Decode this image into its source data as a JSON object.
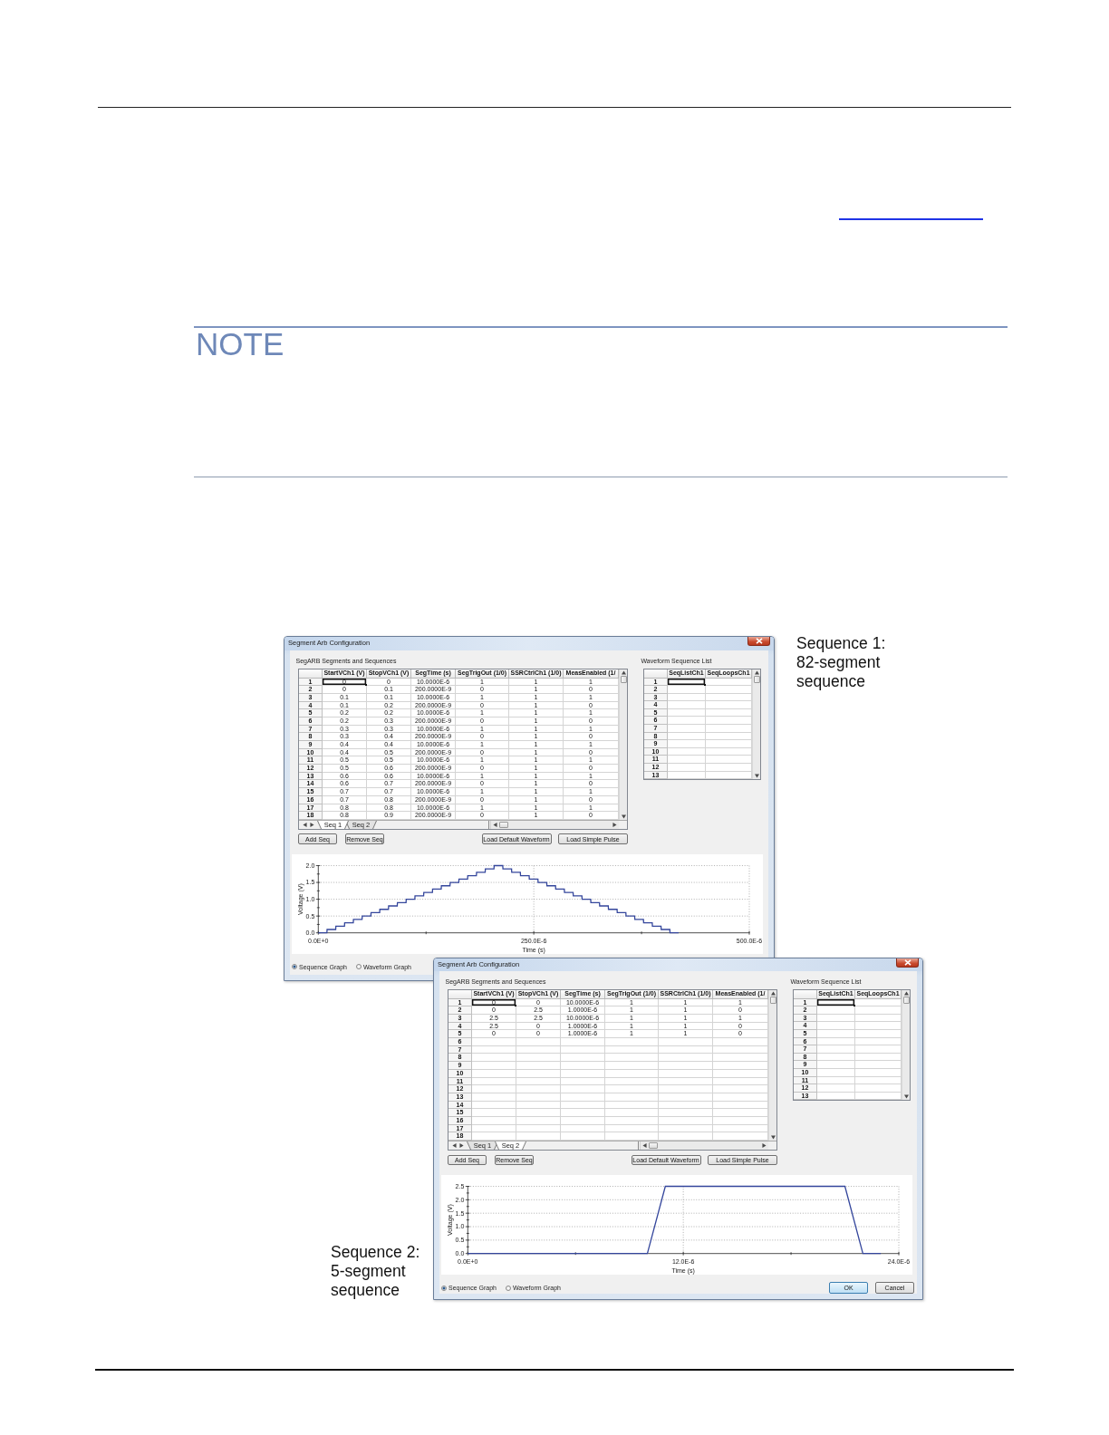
{
  "note": {
    "heading": "NOTE"
  },
  "figure": {
    "windows": [
      {
        "title": "Segment Arb Configuration",
        "caption": "Sequence 1: 82-segment sequence",
        "segments": {
          "label": "SegARB Segments and Sequences",
          "columns": [
            "StartVCh1 (V)",
            "StopVCh1 (V)",
            "SegTime (s)",
            "SegTrigOut (1/0)",
            "SSRCtrlCh1 (1/0)",
            "MeasEnabled (1/"
          ],
          "rows": [
            {
              "number": "1",
              "selected": true,
              "cells": [
                "0",
                "0",
                "10.0000E-6",
                "1",
                "1",
                "1"
              ]
            },
            {
              "number": "2",
              "selected": false,
              "cells": [
                "0",
                "0.1",
                "200.0000E-9",
                "0",
                "1",
                "0"
              ]
            },
            {
              "number": "3",
              "selected": false,
              "cells": [
                "0.1",
                "0.1",
                "10.0000E-6",
                "1",
                "1",
                "1"
              ]
            },
            {
              "number": "4",
              "selected": false,
              "cells": [
                "0.1",
                "0.2",
                "200.0000E-9",
                "0",
                "1",
                "0"
              ]
            },
            {
              "number": "5",
              "selected": false,
              "cells": [
                "0.2",
                "0.2",
                "10.0000E-6",
                "1",
                "1",
                "1"
              ]
            },
            {
              "number": "6",
              "selected": false,
              "cells": [
                "0.2",
                "0.3",
                "200.0000E-9",
                "0",
                "1",
                "0"
              ]
            },
            {
              "number": "7",
              "selected": false,
              "cells": [
                "0.3",
                "0.3",
                "10.0000E-6",
                "1",
                "1",
                "1"
              ]
            },
            {
              "number": "8",
              "selected": false,
              "cells": [
                "0.3",
                "0.4",
                "200.0000E-9",
                "0",
                "1",
                "0"
              ]
            },
            {
              "number": "9",
              "selected": false,
              "cells": [
                "0.4",
                "0.4",
                "10.0000E-6",
                "1",
                "1",
                "1"
              ]
            },
            {
              "number": "10",
              "selected": false,
              "cells": [
                "0.4",
                "0.5",
                "200.0000E-9",
                "0",
                "1",
                "0"
              ]
            },
            {
              "number": "11",
              "selected": false,
              "cells": [
                "0.5",
                "0.5",
                "10.0000E-6",
                "1",
                "1",
                "1"
              ]
            },
            {
              "number": "12",
              "selected": false,
              "cells": [
                "0.5",
                "0.6",
                "200.0000E-9",
                "0",
                "1",
                "0"
              ]
            },
            {
              "number": "13",
              "selected": false,
              "cells": [
                "0.6",
                "0.6",
                "10.0000E-6",
                "1",
                "1",
                "1"
              ]
            },
            {
              "number": "14",
              "selected": false,
              "cells": [
                "0.6",
                "0.7",
                "200.0000E-9",
                "0",
                "1",
                "0"
              ]
            },
            {
              "number": "15",
              "selected": false,
              "cells": [
                "0.7",
                "0.7",
                "10.0000E-6",
                "1",
                "1",
                "1"
              ]
            },
            {
              "number": "16",
              "selected": false,
              "cells": [
                "0.7",
                "0.8",
                "200.0000E-9",
                "0",
                "1",
                "0"
              ]
            },
            {
              "number": "17",
              "selected": false,
              "cells": [
                "0.8",
                "0.8",
                "10.0000E-6",
                "1",
                "1",
                "1"
              ]
            },
            {
              "number": "18",
              "selected": false,
              "cells": [
                "0.8",
                "0.9",
                "200.0000E-9",
                "0",
                "1",
                "0"
              ]
            }
          ],
          "sheet_tabs": [
            {
              "label": "Seq 1",
              "selected": true
            },
            {
              "label": "Seq 2",
              "selected": false
            }
          ]
        },
        "sequence_buttons": [
          "Add Seq",
          "Remove Seq"
        ],
        "waveform_buttons": [
          "Load Default Waveform",
          "Load Simple Pulse"
        ],
        "sequence_list": {
          "label": "Waveform Sequence List",
          "columns": [
            "SeqListCh1",
            "SeqLoopsCh1"
          ],
          "rows": [
            {
              "number": "1",
              "selected": true
            },
            {
              "number": "2",
              "selected": false
            },
            {
              "number": "3",
              "selected": false
            },
            {
              "number": "4",
              "selected": false
            },
            {
              "number": "5",
              "selected": false
            },
            {
              "number": "6",
              "selected": false
            },
            {
              "number": "7",
              "selected": false
            },
            {
              "number": "8",
              "selected": false
            },
            {
              "number": "9",
              "selected": false
            },
            {
              "number": "10",
              "selected": false
            },
            {
              "number": "11",
              "selected": false
            },
            {
              "number": "12",
              "selected": false
            },
            {
              "number": "13",
              "selected": false
            }
          ]
        },
        "graph": {
          "chart_data": {
            "type": "line",
            "grid": true,
            "xlabel": "Time (s)",
            "ylabel": "Voltage (V)",
            "x": [
              0,
              1e-05,
              1.02e-05,
              2.02e-05,
              2.04e-05,
              3.04e-05,
              3.06e-05,
              4.06e-05,
              4.08e-05,
              5.08e-05,
              5.1e-05,
              6.1e-05,
              6.12e-05,
              7.12e-05,
              7.14e-05,
              8.14e-05,
              8.16e-05,
              9.16e-05,
              9.18e-05,
              0.0001018,
              0.000102,
              0.000112,
              0.0001122,
              0.0001222,
              0.0001224,
              0.0001324,
              0.0001326,
              0.0001426,
              0.0001428,
              0.0001528,
              0.000153,
              0.000163,
              0.0001632,
              0.0001732,
              0.0001734,
              0.0001834,
              0.0001836,
              0.0001936,
              0.0001938,
              0.0002038,
              0.000204,
              0.000214,
              0.0002142,
              0.0002242,
              0.0002244,
              0.0002344,
              0.0002346,
              0.0002446,
              0.0002448,
              0.0002548,
              0.000255,
              0.000265,
              0.0002652,
              0.0002752,
              0.0002754,
              0.0002854,
              0.0002856,
              0.0002956,
              0.0002958,
              0.0003058,
              0.000306,
              0.000316,
              0.0003162,
              0.0003262,
              0.0003264,
              0.0003364,
              0.0003366,
              0.0003466,
              0.0003468,
              0.0003568,
              0.000357,
              0.000367,
              0.0003672,
              0.0003772,
              0.0003774,
              0.0003874,
              0.0003876,
              0.0003976,
              0.0003978,
              0.0004078,
              0.000408,
              0.000418
            ],
            "values": [
              0,
              0,
              0.1,
              0.1,
              0.2,
              0.2,
              0.3,
              0.3,
              0.4,
              0.4,
              0.5,
              0.5,
              0.6,
              0.6,
              0.7,
              0.7,
              0.8,
              0.8,
              0.9,
              0.9,
              1,
              1,
              1.1,
              1.1,
              1.2,
              1.2,
              1.3,
              1.3,
              1.4,
              1.4,
              1.5,
              1.5,
              1.6,
              1.6,
              1.7,
              1.7,
              1.8,
              1.8,
              1.9,
              1.9,
              2,
              2,
              1.9,
              1.9,
              1.8,
              1.8,
              1.7,
              1.7,
              1.6,
              1.6,
              1.5,
              1.5,
              1.4,
              1.4,
              1.3,
              1.3,
              1.2,
              1.2,
              1.1,
              1.1,
              1,
              1,
              0.9,
              0.9,
              0.8,
              0.8,
              0.7,
              0.7,
              0.6,
              0.6,
              0.5,
              0.5,
              0.4,
              0.4,
              0.3,
              0.3,
              0.2,
              0.2,
              0.1,
              0.1,
              0,
              0
            ],
            "xlim": [
              0,
              0.0005
            ],
            "ylim": [
              0,
              2
            ],
            "xticks": [
              {
                "value": 0,
                "label": "0.0E+0"
              },
              {
                "value": 0.00025,
                "label": "250.0E-6"
              },
              {
                "value": 0.0005,
                "label": "500.0E-6"
              }
            ],
            "yticks": [
              {
                "value": 0,
                "label": "0.0"
              },
              {
                "value": 0.5,
                "label": "0.5"
              },
              {
                "value": 1,
                "label": "1.0"
              },
              {
                "value": 1.5,
                "label": "1.5"
              },
              {
                "value": 2,
                "label": "2.0"
              }
            ]
          }
        },
        "graph_options": [
          {
            "label": "Sequence Graph",
            "selected": true
          },
          {
            "label": "Waveform Graph",
            "selected": false
          }
        ]
      },
      {
        "title": "Segment Arb Configuration",
        "caption": "Sequence 2: 5-segment sequence",
        "segments": {
          "label": "SegARB Segments and Sequences",
          "columns": [
            "StartVCh1 (V)",
            "StopVCh1 (V)",
            "SegTime (s)",
            "SegTrigOut (1/0)",
            "SSRCtrlCh1 (1/0)",
            "MeasEnabled (1/"
          ],
          "rows": [
            {
              "number": "1",
              "selected": true,
              "cells": [
                "0",
                "0",
                "10.0000E-6",
                "1",
                "1",
                "1"
              ]
            },
            {
              "number": "2",
              "selected": false,
              "cells": [
                "0",
                "2.5",
                "1.0000E-6",
                "1",
                "1",
                "0"
              ]
            },
            {
              "number": "3",
              "selected": false,
              "cells": [
                "2.5",
                "2.5",
                "10.0000E-6",
                "1",
                "1",
                "1"
              ]
            },
            {
              "number": "4",
              "selected": false,
              "cells": [
                "2.5",
                "0",
                "1.0000E-6",
                "1",
                "1",
                "0"
              ]
            },
            {
              "number": "5",
              "selected": false,
              "cells": [
                "0",
                "0",
                "1.0000E-6",
                "1",
                "1",
                "0"
              ]
            },
            {
              "number": "6",
              "selected": false
            },
            {
              "number": "7",
              "selected": false
            },
            {
              "number": "8",
              "selected": false
            },
            {
              "number": "9",
              "selected": false
            },
            {
              "number": "10",
              "selected": false
            },
            {
              "number": "11",
              "selected": false
            },
            {
              "number": "12",
              "selected": false
            },
            {
              "number": "13",
              "selected": false
            },
            {
              "number": "14",
              "selected": false
            },
            {
              "number": "15",
              "selected": false
            },
            {
              "number": "16",
              "selected": false
            },
            {
              "number": "17",
              "selected": false
            },
            {
              "number": "18",
              "selected": false
            }
          ],
          "sheet_tabs": [
            {
              "label": "Seq 1",
              "selected": false
            },
            {
              "label": "Seq 2",
              "selected": true
            }
          ]
        },
        "sequence_buttons": [
          "Add Seq",
          "Remove Seq"
        ],
        "waveform_buttons": [
          "Load Default Waveform",
          "Load Simple Pulse"
        ],
        "sequence_list": {
          "label": "Waveform Sequence List",
          "columns": [
            "SeqListCh1",
            "SeqLoopsCh1"
          ],
          "rows": [
            {
              "number": "1",
              "selected": true
            },
            {
              "number": "2",
              "selected": false
            },
            {
              "number": "3",
              "selected": false
            },
            {
              "number": "4",
              "selected": false
            },
            {
              "number": "5",
              "selected": false
            },
            {
              "number": "6",
              "selected": false
            },
            {
              "number": "7",
              "selected": false
            },
            {
              "number": "8",
              "selected": false
            },
            {
              "number": "9",
              "selected": false
            },
            {
              "number": "10",
              "selected": false
            },
            {
              "number": "11",
              "selected": false
            },
            {
              "number": "12",
              "selected": false
            },
            {
              "number": "13",
              "selected": false
            }
          ]
        },
        "graph": {
          "chart_data": {
            "type": "line",
            "grid": true,
            "xlabel": "Time (s)",
            "ylabel": "Voltage (V)",
            "x": [
              0,
              1e-05,
              1.1e-05,
              2.1e-05,
              2.2e-05,
              2.3e-05
            ],
            "values": [
              0,
              0,
              2.5,
              2.5,
              0,
              0
            ],
            "xlim": [
              0,
              2.4e-05
            ],
            "ylim": [
              0,
              2.5
            ],
            "xticks": [
              {
                "value": 0,
                "label": "0.0E+0"
              },
              {
                "value": 1.2e-05,
                "label": "12.0E-6"
              },
              {
                "value": 2.4e-05,
                "label": "24.0E-6"
              }
            ],
            "yticks": [
              {
                "value": 0,
                "label": "0.0"
              },
              {
                "value": 0.5,
                "label": "0.5"
              },
              {
                "value": 1,
                "label": "1.0"
              },
              {
                "value": 1.5,
                "label": "1.5"
              },
              {
                "value": 2,
                "label": "2.0"
              },
              {
                "value": 2.5,
                "label": "2.5"
              }
            ]
          }
        },
        "graph_options": [
          {
            "label": "Sequence Graph",
            "selected": true
          },
          {
            "label": "Waveform Graph",
            "selected": false
          }
        ],
        "dialog_buttons": [
          {
            "label": "OK",
            "default": true
          },
          {
            "label": "Cancel",
            "default": false
          }
        ]
      }
    ]
  }
}
